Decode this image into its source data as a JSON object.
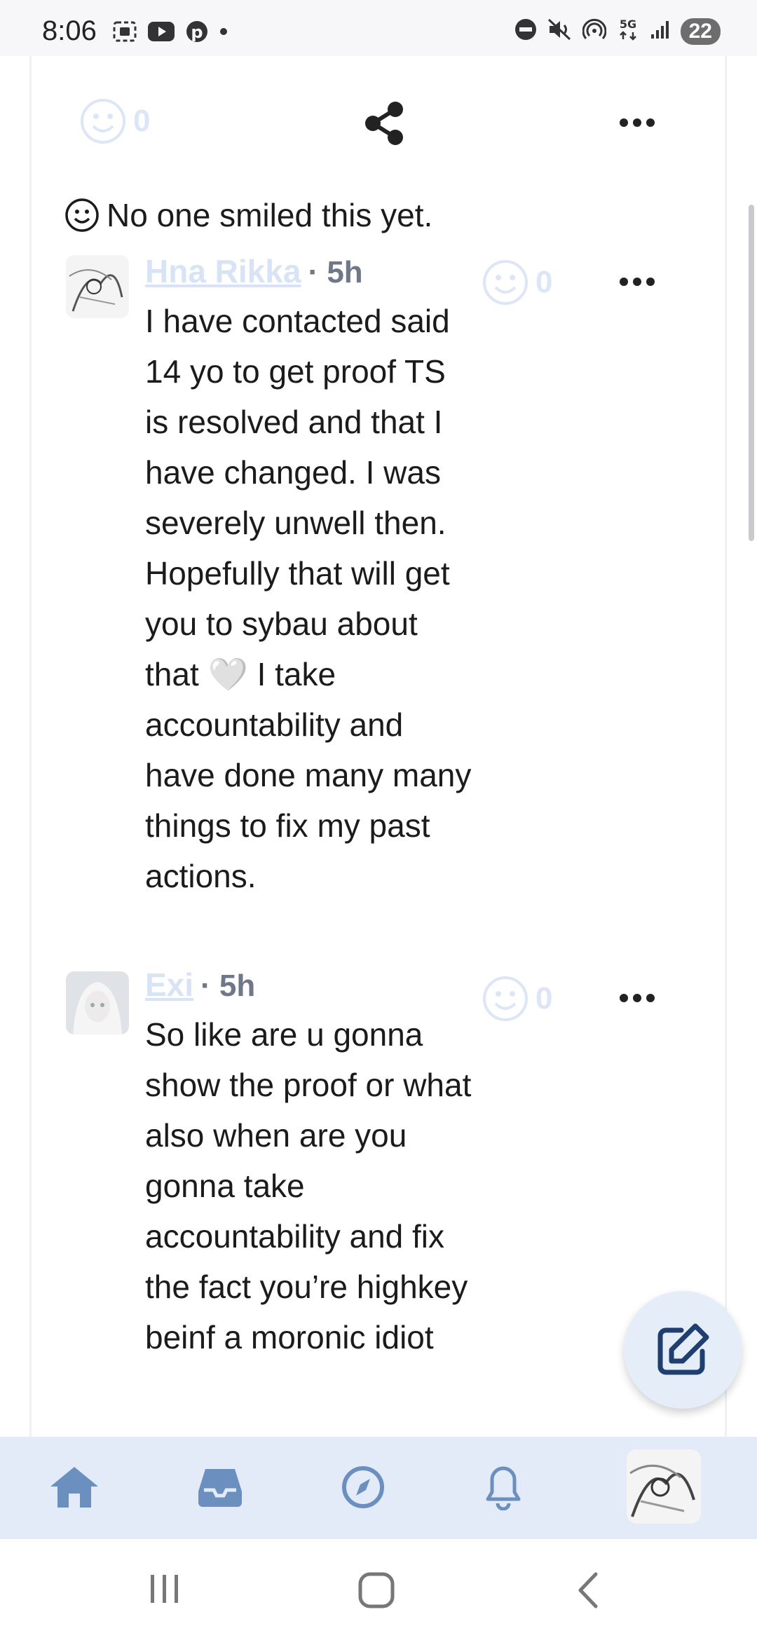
{
  "status_bar": {
    "time": "8:06",
    "network": "5G",
    "battery": "22",
    "left_icons": [
      "screenshot-icon",
      "youtube-icon",
      "pinterest-icon",
      "dot-icon"
    ],
    "right_icons": [
      "do-not-disturb-icon",
      "mute-icon",
      "hotspot-icon",
      "5g-icon",
      "signal-icon",
      "battery-icon"
    ]
  },
  "post_actions": {
    "smile_count": "0"
  },
  "no_smile_text": "No one smiled this yet.",
  "comments": [
    {
      "author": "Hna Rikka",
      "time": "· 5h",
      "smile_count": "0",
      "text": "I have contacted said 14 yo to get proof TS is resolved and that I have changed. I was severely unwell then. Hopefully that will get you to sybau about that 🤍 I take accountability and have done many many things to fix my past actions."
    },
    {
      "author": "Exi",
      "time": "· 5h",
      "smile_count": "0",
      "text": "So like are u gonna show the proof or what also when are you gonna take accountability and fix the fact you’re highkey beinf a moronic idiot"
    }
  ],
  "colors": {
    "accent_light": "#e2ebf7",
    "nav_icon": "#6b8fbf",
    "fab_icon": "#1f3f6f"
  },
  "bottom_nav": [
    "home-icon",
    "inbox-icon",
    "explore-icon",
    "bell-icon",
    "profile-avatar"
  ]
}
